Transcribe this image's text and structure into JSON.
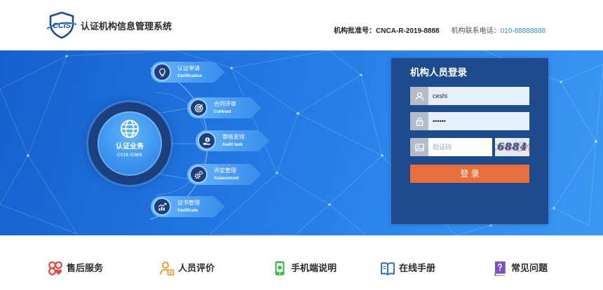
{
  "header": {
    "logo_text": "CCIS",
    "logo_icon": "ccis-shield-logo",
    "system_title": "认证机构信息管理系统",
    "approval_label": "机构批准号：",
    "approval_number": "CNCA-R-2019-8888",
    "phone_label": "机构联系电话：",
    "phone_number": "010-88888888"
  },
  "hub": {
    "title": "认证业务",
    "subtitle": "CCIS-CIMS",
    "icon": "globe-icon"
  },
  "modules": [
    {
      "cn": "认证申请",
      "en": "Certification",
      "icon": "lightbulb-icon"
    },
    {
      "cn": "合同评审",
      "en": "Contract",
      "icon": "target-icon"
    },
    {
      "cn": "审核安排",
      "en": "Audit task",
      "icon": "money-hand-icon"
    },
    {
      "cn": "评定管理",
      "en": "Assessment",
      "icon": "gears-icon"
    },
    {
      "cn": "证书管理",
      "en": "Certificate",
      "icon": "growth-chart-icon"
    }
  ],
  "login": {
    "title": "机构人员登录",
    "username_value": "ceshi",
    "password_value": "••••••",
    "captcha_placeholder": "验证码",
    "captcha_text": "6884",
    "button_label": "登 录",
    "icons": {
      "username": "user-icon",
      "password": "lock-icon",
      "captcha": "image-icon"
    }
  },
  "footer": {
    "items": [
      {
        "label": "售后服务",
        "icon": "after-sales-service-icon",
        "color": "#e8453c"
      },
      {
        "label": "人员评价",
        "icon": "person-rating-icon",
        "color": "#f39a2e"
      },
      {
        "label": "手机端说明",
        "icon": "mobile-phone-icon",
        "color": "#3bb54a"
      },
      {
        "label": "在线手册",
        "icon": "open-book-icon",
        "color": "#2a6fc9"
      },
      {
        "label": "常见问题",
        "icon": "faq-book-icon",
        "color": "#7d4fc6"
      }
    ]
  },
  "colors": {
    "banner": "#2275e0",
    "hub_ring": "#1c3f7e",
    "login_panel": "#1d4b8e",
    "login_button": "#e8713b",
    "phone_link": "#3b8de0"
  }
}
